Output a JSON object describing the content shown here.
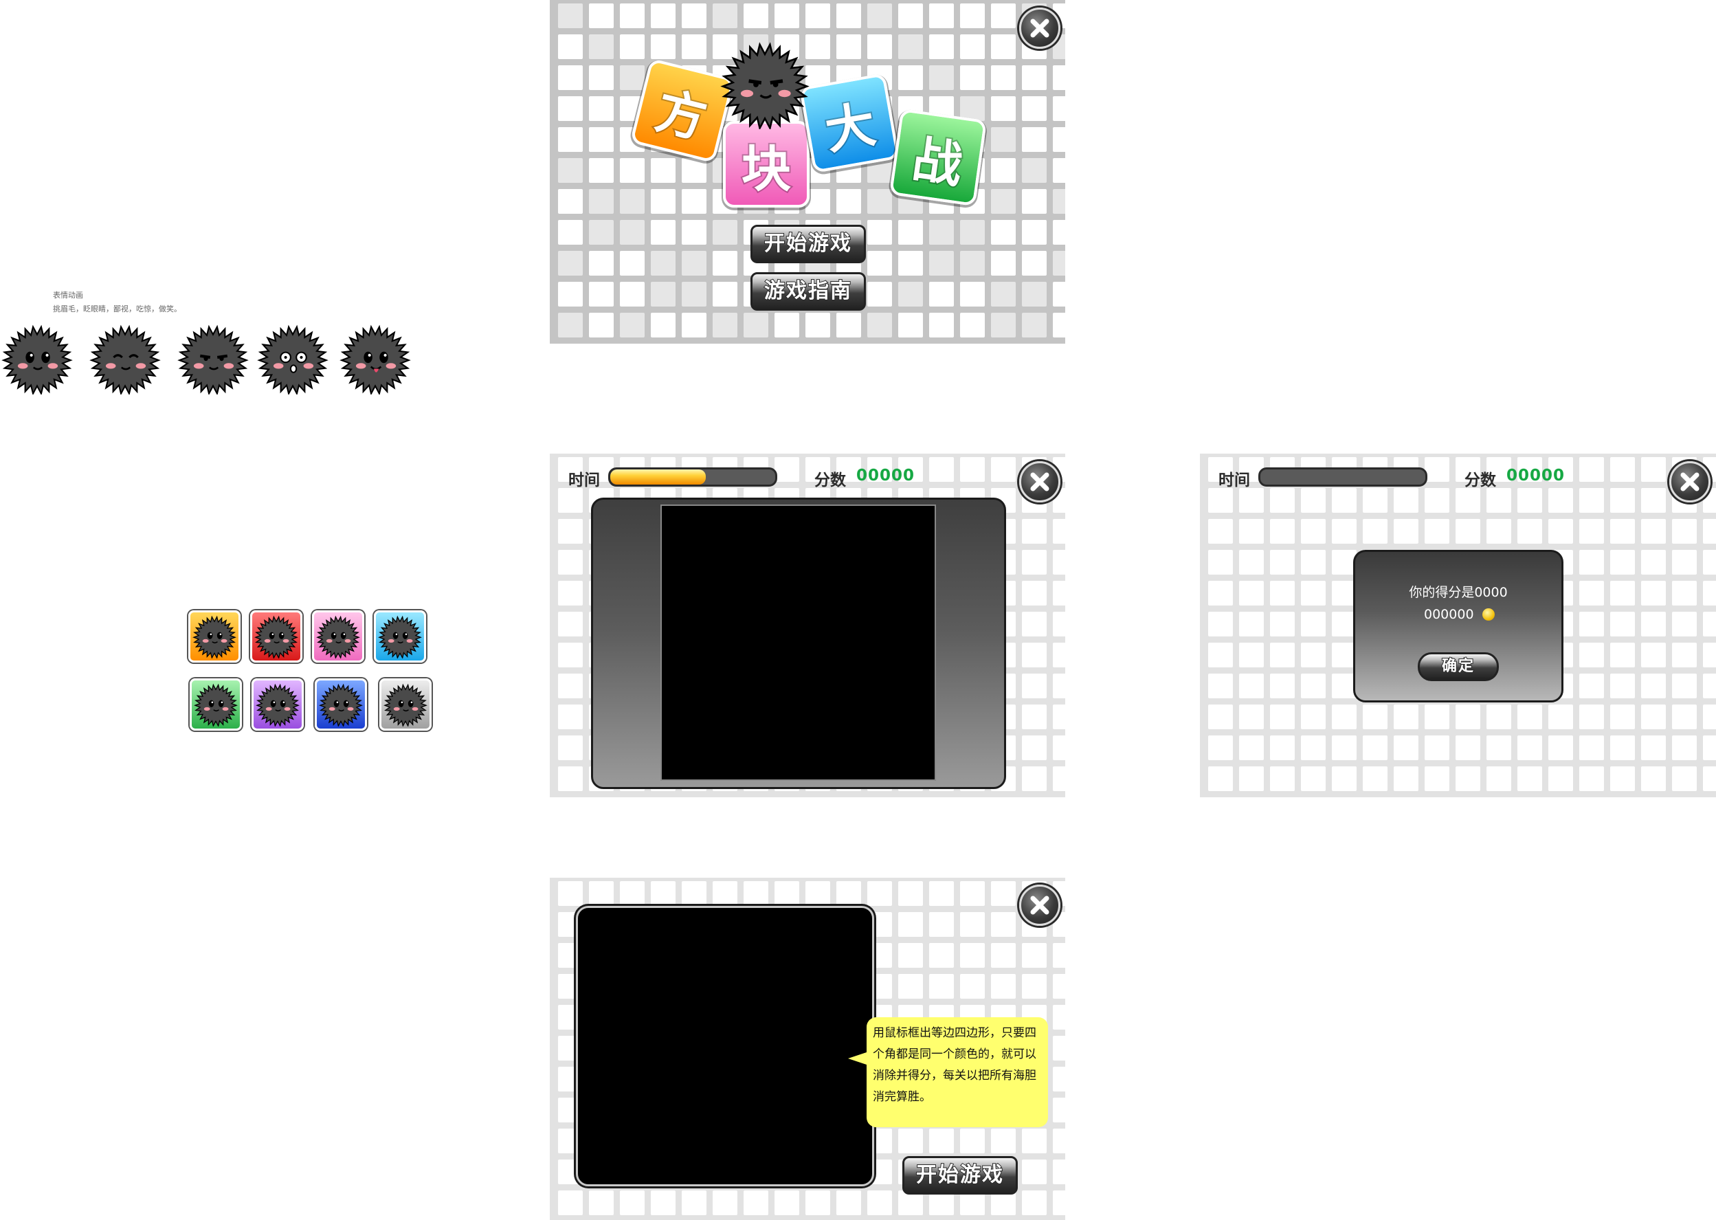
{
  "emotions": {
    "title": "表情动画",
    "subtitle": "挑眉毛，眨眼睛，鄙视，吃惊，做笑。"
  },
  "title_screen": {
    "logo_chars": [
      "方",
      "块",
      "大",
      "战"
    ],
    "start_button": "开始游戏",
    "guide_button": "游戏指南"
  },
  "game_screen": {
    "time_label": "时间",
    "score_label": "分数",
    "score_value": "00000",
    "time_progress": 0.58
  },
  "result_screen": {
    "time_label": "时间",
    "score_label": "分数",
    "score_value": "00000",
    "time_progress": 0,
    "popup_line1": "你的得分是0000",
    "popup_line2": "000000",
    "ok_button": "确定"
  },
  "guide_screen": {
    "instruction": "用鼠标框出等边四边形，只要四个角都是同一个颜色的，就可以消除并得分，每关以把所有海胆消完算胜。",
    "start_button": "开始游戏"
  },
  "colors": {
    "score_green": "#16a843",
    "bubble_yellow": "#ffff6e"
  },
  "tile_colors": [
    "orange",
    "red",
    "pink",
    "cyan",
    "green",
    "purple",
    "blue",
    "gray"
  ]
}
